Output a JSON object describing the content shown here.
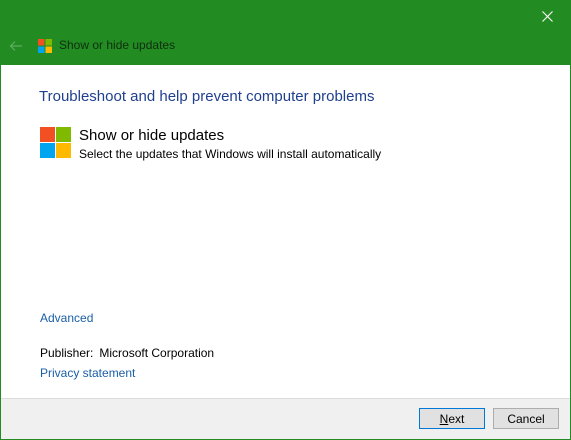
{
  "window": {
    "title": "Show or hide updates",
    "accent_color": "#228b22"
  },
  "icons": {
    "close": "close-icon",
    "back": "back-arrow-icon",
    "logo": "windows-logo-icon"
  },
  "logo_colors": {
    "top_left": "#f25022",
    "top_right": "#7fba00",
    "bottom_left": "#00a4ef",
    "bottom_right": "#ffb900"
  },
  "content": {
    "heading": "Troubleshoot and help prevent computer problems",
    "item_title": "Show or hide updates",
    "item_description": "Select the updates that Windows will install automatically",
    "advanced_link": "Advanced",
    "publisher_label": "Publisher:",
    "publisher_value": "Microsoft Corporation",
    "privacy_link": "Privacy statement"
  },
  "buttons": {
    "next_mnemonic": "N",
    "next_rest": "ext",
    "cancel": "Cancel"
  }
}
